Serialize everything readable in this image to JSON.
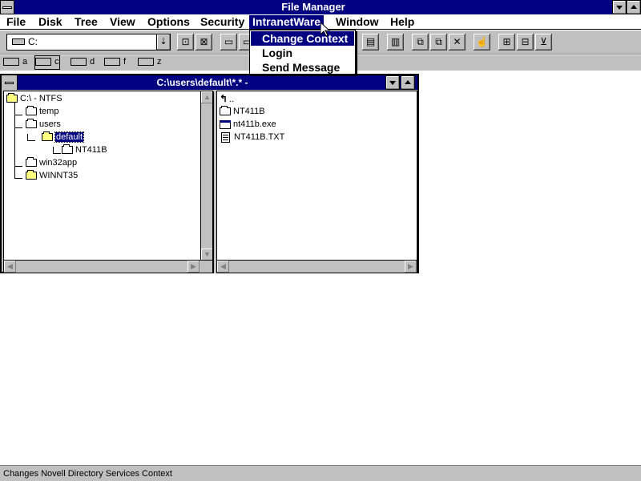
{
  "app": {
    "title": "File Manager"
  },
  "menubar": {
    "items": [
      "File",
      "Disk",
      "Tree",
      "View",
      "Options",
      "Security",
      "IntranetWare",
      "Window",
      "Help"
    ],
    "active": "IntranetWare"
  },
  "intranetware_menu": {
    "items": [
      "Change Context",
      "Login",
      "Send Message"
    ],
    "highlighted": "Change Context"
  },
  "toolbar": {
    "drive_value": "C:",
    "button_icons": [
      "connect-net-drive-icon",
      "disconnect-net-drive-icon",
      "share-icon",
      "stop-sharing-icon",
      "tree-only-icon",
      "tree-and-dir-icon",
      "dir-only-icon",
      "copy-icon",
      "move-icon",
      "delete-icon",
      "properties-icon",
      "sort-by-name-icon",
      "sort-by-type-icon",
      "permissions-icon"
    ]
  },
  "drives": [
    {
      "letter": "a",
      "icon": "floppy-drive-icon"
    },
    {
      "letter": "c",
      "icon": "hard-drive-icon",
      "selected": true
    },
    {
      "letter": "d",
      "icon": "network-drive-icon"
    },
    {
      "letter": "f",
      "icon": "network-drive-icon"
    },
    {
      "letter": "z",
      "icon": "network-drive-icon"
    }
  ],
  "dirwindow": {
    "title": "C:\\users\\default\\*.* -",
    "tree": [
      {
        "label": "C:\\ - NTFS",
        "icon": "open-folder-icon"
      },
      {
        "label": "temp",
        "icon": "folder-icon"
      },
      {
        "label": "users",
        "icon": "folder-icon"
      },
      {
        "label": "default",
        "icon": "open-folder-icon",
        "selected": true
      },
      {
        "label": "NT411B",
        "icon": "folder-icon"
      },
      {
        "label": "win32app",
        "icon": "folder-icon"
      },
      {
        "label": "WINNT35",
        "icon": "folder-icon"
      }
    ],
    "files": [
      {
        "label": "..",
        "icon": "up-directory-icon"
      },
      {
        "label": "NT411B",
        "icon": "folder-icon"
      },
      {
        "label": "nt411b.exe",
        "icon": "program-file-icon"
      },
      {
        "label": "NT411B.TXT",
        "icon": "document-file-icon"
      }
    ]
  },
  "status": {
    "text": "Changes Novell Directory Services Context"
  }
}
